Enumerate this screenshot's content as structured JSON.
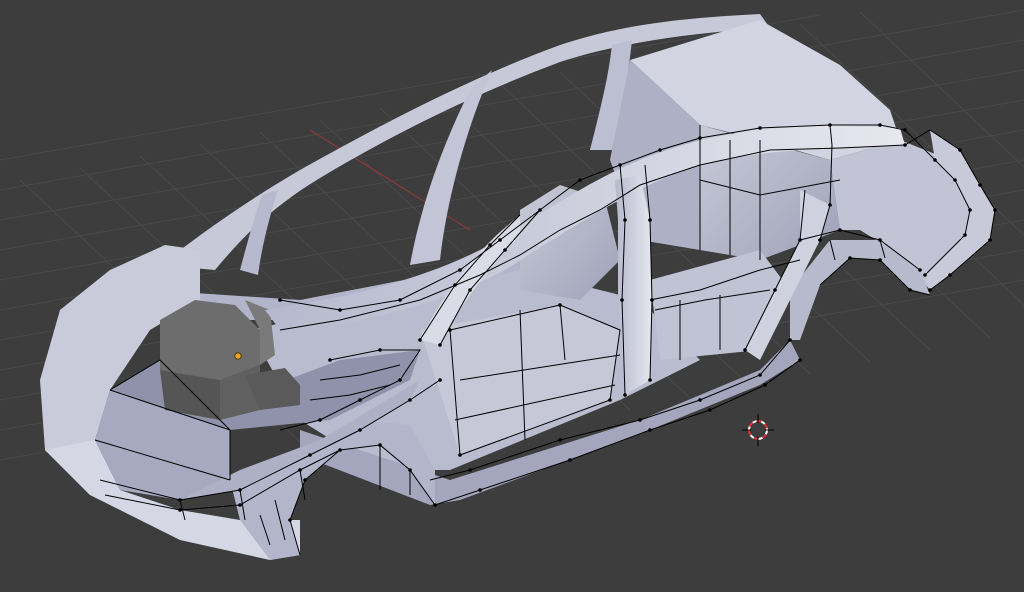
{
  "app": "Blender",
  "viewport": {
    "view": "3d-viewport",
    "shading": "solid",
    "mode": "edit",
    "object": "car-body-mesh",
    "grid_visible": true,
    "colors": {
      "background": "#3d3d3d",
      "grid": "#4b4b4b",
      "x_axis": "#8a3a3a",
      "mesh_light": "#d6d8e6",
      "mesh_mid": "#b4b7cc",
      "mesh_shadow": "#8d90a8",
      "engine": "#6a6a6a",
      "edges": "#000000",
      "cursor_red": "#e03030",
      "origin": "#f0a020"
    }
  },
  "icons": {
    "cursor": "3d-cursor-icon",
    "origin": "object-origin-icon"
  }
}
